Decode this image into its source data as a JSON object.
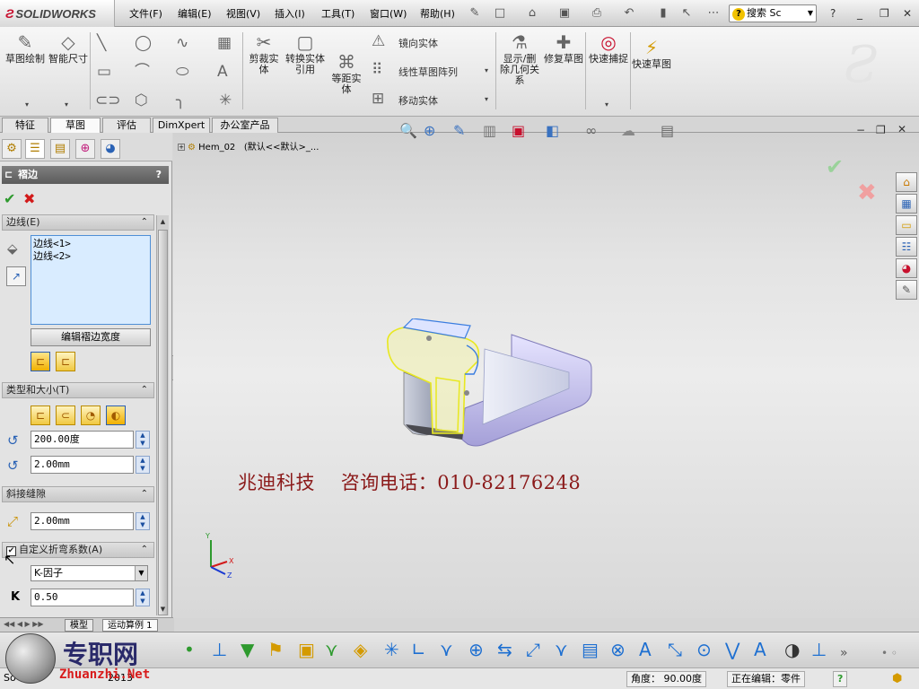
{
  "app": {
    "logo": "SOLIDWORKS",
    "menus": [
      "文件(F)",
      "编辑(E)",
      "视图(V)",
      "插入(I)",
      "工具(T)",
      "窗口(W)",
      "帮助(H)"
    ],
    "search_placeholder": "搜索 Sc",
    "help_icon": "?"
  },
  "ribbon": {
    "sketch": "草图绘制",
    "smart_dim": "智能尺寸",
    "trim": "剪裁实体",
    "convert": "转换实体引用",
    "offset": "等距实体",
    "mirror": "镜向实体",
    "linear_pattern": "线性草图阵列",
    "move": "移动实体",
    "display_rel": "显示/删除几何关系",
    "repair": "修复草图",
    "quick_snap": "快速捕捉",
    "rapid_sketch": "快速草图"
  },
  "tabs": [
    "特征",
    "草图",
    "评估",
    "DimXpert",
    "办公室产品"
  ],
  "tree": {
    "item": "Hem_02",
    "config": "(默认<<默认>_..."
  },
  "panel": {
    "title": "褶边",
    "help": "?",
    "edges_group": "边线(E)",
    "edges": [
      "边线<1>",
      "边线<2>"
    ],
    "edit_width_btn": "编辑褶边宽度",
    "type_size_group": "类型和大小(T)",
    "angle": "200.00度",
    "radius": "2.00mm",
    "miter_group": "斜接缝隙",
    "miter_gap": "2.00mm",
    "custom_bend_group": "自定义折弯系数(A)",
    "bend_type": "K-因子",
    "k_label": "K",
    "k_value": "0.50"
  },
  "bottom_tabs": [
    "模型",
    "运动算例 1"
  ],
  "watermark": "兆迪科技    咨询电话：010-82176248",
  "status": {
    "app_short": "So",
    "year": "2013",
    "angle": "角度： 90.00度",
    "editing": "正在编辑：零件",
    "help": "?"
  },
  "brand": {
    "site_cn": "专职网",
    "site_url": "Zhuanzhi.Net"
  },
  "triad": {
    "y": "Y",
    "x": "X",
    "z": "Z"
  },
  "colors": {
    "part_face": "#c9cde6",
    "part_highlight": "#f2f24a",
    "watermark": "#8b1a1a"
  }
}
